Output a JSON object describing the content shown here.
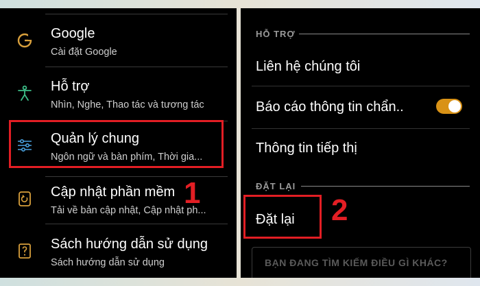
{
  "left_menu": {
    "items": [
      {
        "icon": "google-icon",
        "title": "Google",
        "subtitle": "Cài đặt Google"
      },
      {
        "icon": "accessibility-icon",
        "title": "Hỗ trợ",
        "subtitle": "Nhìn, Nghe, Thao tác và tương tác"
      },
      {
        "icon": "sliders-icon",
        "title": "Quản lý chung",
        "subtitle": "Ngôn ngữ và bàn phím, Thời gia..."
      },
      {
        "icon": "software-update-icon",
        "title": "Cập nhật phần mềm",
        "subtitle": "Tải về bản cập nhật, Cập nhật ph..."
      },
      {
        "icon": "user-manual-icon",
        "title": "Sách hướng dẫn sử dụng",
        "subtitle": "Sách hướng dẫn sử dụng"
      }
    ]
  },
  "right_menu": {
    "support_header": "HỖ TRỢ",
    "contact": "Liên hệ chúng tôi",
    "diagnostics": "Báo cáo thông tin chẩn..",
    "diagnostics_enabled": true,
    "marketing": "Thông tin tiếp thị",
    "reset_header": "ĐẶT LẠI",
    "reset": "Đặt lại",
    "search_prompt": "BẠN ĐANG TÌM KIẾM ĐIỀU GÌ KHÁC?"
  },
  "annotations": {
    "step1": "1",
    "step2": "2"
  },
  "colors": {
    "highlight": "#e31e24",
    "accent": "#d99216",
    "icon": "#d9a03c",
    "accessibility_icon": "#3dbf88",
    "sliders_icon": "#4aa3e0"
  }
}
